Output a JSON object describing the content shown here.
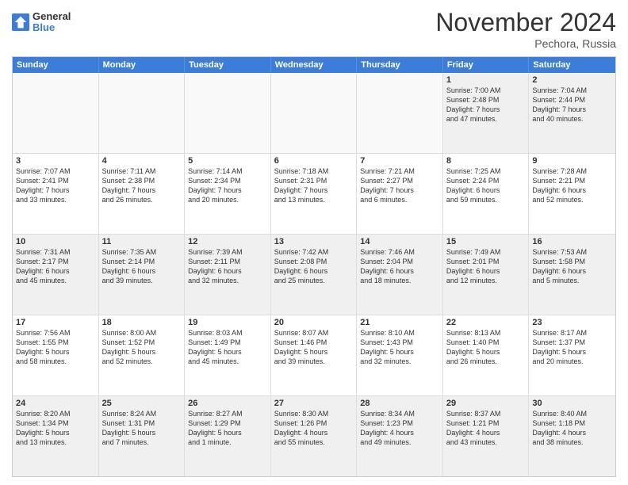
{
  "header": {
    "logo_general": "General",
    "logo_blue": "Blue",
    "month_title": "November 2024",
    "location": "Pechora, Russia"
  },
  "weekdays": [
    "Sunday",
    "Monday",
    "Tuesday",
    "Wednesday",
    "Thursday",
    "Friday",
    "Saturday"
  ],
  "rows": [
    [
      {
        "day": "",
        "info": ""
      },
      {
        "day": "",
        "info": ""
      },
      {
        "day": "",
        "info": ""
      },
      {
        "day": "",
        "info": ""
      },
      {
        "day": "",
        "info": ""
      },
      {
        "day": "1",
        "info": "Sunrise: 7:00 AM\nSunset: 2:48 PM\nDaylight: 7 hours\nand 47 minutes."
      },
      {
        "day": "2",
        "info": "Sunrise: 7:04 AM\nSunset: 2:44 PM\nDaylight: 7 hours\nand 40 minutes."
      }
    ],
    [
      {
        "day": "3",
        "info": "Sunrise: 7:07 AM\nSunset: 2:41 PM\nDaylight: 7 hours\nand 33 minutes."
      },
      {
        "day": "4",
        "info": "Sunrise: 7:11 AM\nSunset: 2:38 PM\nDaylight: 7 hours\nand 26 minutes."
      },
      {
        "day": "5",
        "info": "Sunrise: 7:14 AM\nSunset: 2:34 PM\nDaylight: 7 hours\nand 20 minutes."
      },
      {
        "day": "6",
        "info": "Sunrise: 7:18 AM\nSunset: 2:31 PM\nDaylight: 7 hours\nand 13 minutes."
      },
      {
        "day": "7",
        "info": "Sunrise: 7:21 AM\nSunset: 2:27 PM\nDaylight: 7 hours\nand 6 minutes."
      },
      {
        "day": "8",
        "info": "Sunrise: 7:25 AM\nSunset: 2:24 PM\nDaylight: 6 hours\nand 59 minutes."
      },
      {
        "day": "9",
        "info": "Sunrise: 7:28 AM\nSunset: 2:21 PM\nDaylight: 6 hours\nand 52 minutes."
      }
    ],
    [
      {
        "day": "10",
        "info": "Sunrise: 7:31 AM\nSunset: 2:17 PM\nDaylight: 6 hours\nand 45 minutes."
      },
      {
        "day": "11",
        "info": "Sunrise: 7:35 AM\nSunset: 2:14 PM\nDaylight: 6 hours\nand 39 minutes."
      },
      {
        "day": "12",
        "info": "Sunrise: 7:39 AM\nSunset: 2:11 PM\nDaylight: 6 hours\nand 32 minutes."
      },
      {
        "day": "13",
        "info": "Sunrise: 7:42 AM\nSunset: 2:08 PM\nDaylight: 6 hours\nand 25 minutes."
      },
      {
        "day": "14",
        "info": "Sunrise: 7:46 AM\nSunset: 2:04 PM\nDaylight: 6 hours\nand 18 minutes."
      },
      {
        "day": "15",
        "info": "Sunrise: 7:49 AM\nSunset: 2:01 PM\nDaylight: 6 hours\nand 12 minutes."
      },
      {
        "day": "16",
        "info": "Sunrise: 7:53 AM\nSunset: 1:58 PM\nDaylight: 6 hours\nand 5 minutes."
      }
    ],
    [
      {
        "day": "17",
        "info": "Sunrise: 7:56 AM\nSunset: 1:55 PM\nDaylight: 5 hours\nand 58 minutes."
      },
      {
        "day": "18",
        "info": "Sunrise: 8:00 AM\nSunset: 1:52 PM\nDaylight: 5 hours\nand 52 minutes."
      },
      {
        "day": "19",
        "info": "Sunrise: 8:03 AM\nSunset: 1:49 PM\nDaylight: 5 hours\nand 45 minutes."
      },
      {
        "day": "20",
        "info": "Sunrise: 8:07 AM\nSunset: 1:46 PM\nDaylight: 5 hours\nand 39 minutes."
      },
      {
        "day": "21",
        "info": "Sunrise: 8:10 AM\nSunset: 1:43 PM\nDaylight: 5 hours\nand 32 minutes."
      },
      {
        "day": "22",
        "info": "Sunrise: 8:13 AM\nSunset: 1:40 PM\nDaylight: 5 hours\nand 26 minutes."
      },
      {
        "day": "23",
        "info": "Sunrise: 8:17 AM\nSunset: 1:37 PM\nDaylight: 5 hours\nand 20 minutes."
      }
    ],
    [
      {
        "day": "24",
        "info": "Sunrise: 8:20 AM\nSunset: 1:34 PM\nDaylight: 5 hours\nand 13 minutes."
      },
      {
        "day": "25",
        "info": "Sunrise: 8:24 AM\nSunset: 1:31 PM\nDaylight: 5 hours\nand 7 minutes."
      },
      {
        "day": "26",
        "info": "Sunrise: 8:27 AM\nSunset: 1:29 PM\nDaylight: 5 hours\nand 1 minute."
      },
      {
        "day": "27",
        "info": "Sunrise: 8:30 AM\nSunset: 1:26 PM\nDaylight: 4 hours\nand 55 minutes."
      },
      {
        "day": "28",
        "info": "Sunrise: 8:34 AM\nSunset: 1:23 PM\nDaylight: 4 hours\nand 49 minutes."
      },
      {
        "day": "29",
        "info": "Sunrise: 8:37 AM\nSunset: 1:21 PM\nDaylight: 4 hours\nand 43 minutes."
      },
      {
        "day": "30",
        "info": "Sunrise: 8:40 AM\nSunset: 1:18 PM\nDaylight: 4 hours\nand 38 minutes."
      }
    ]
  ]
}
